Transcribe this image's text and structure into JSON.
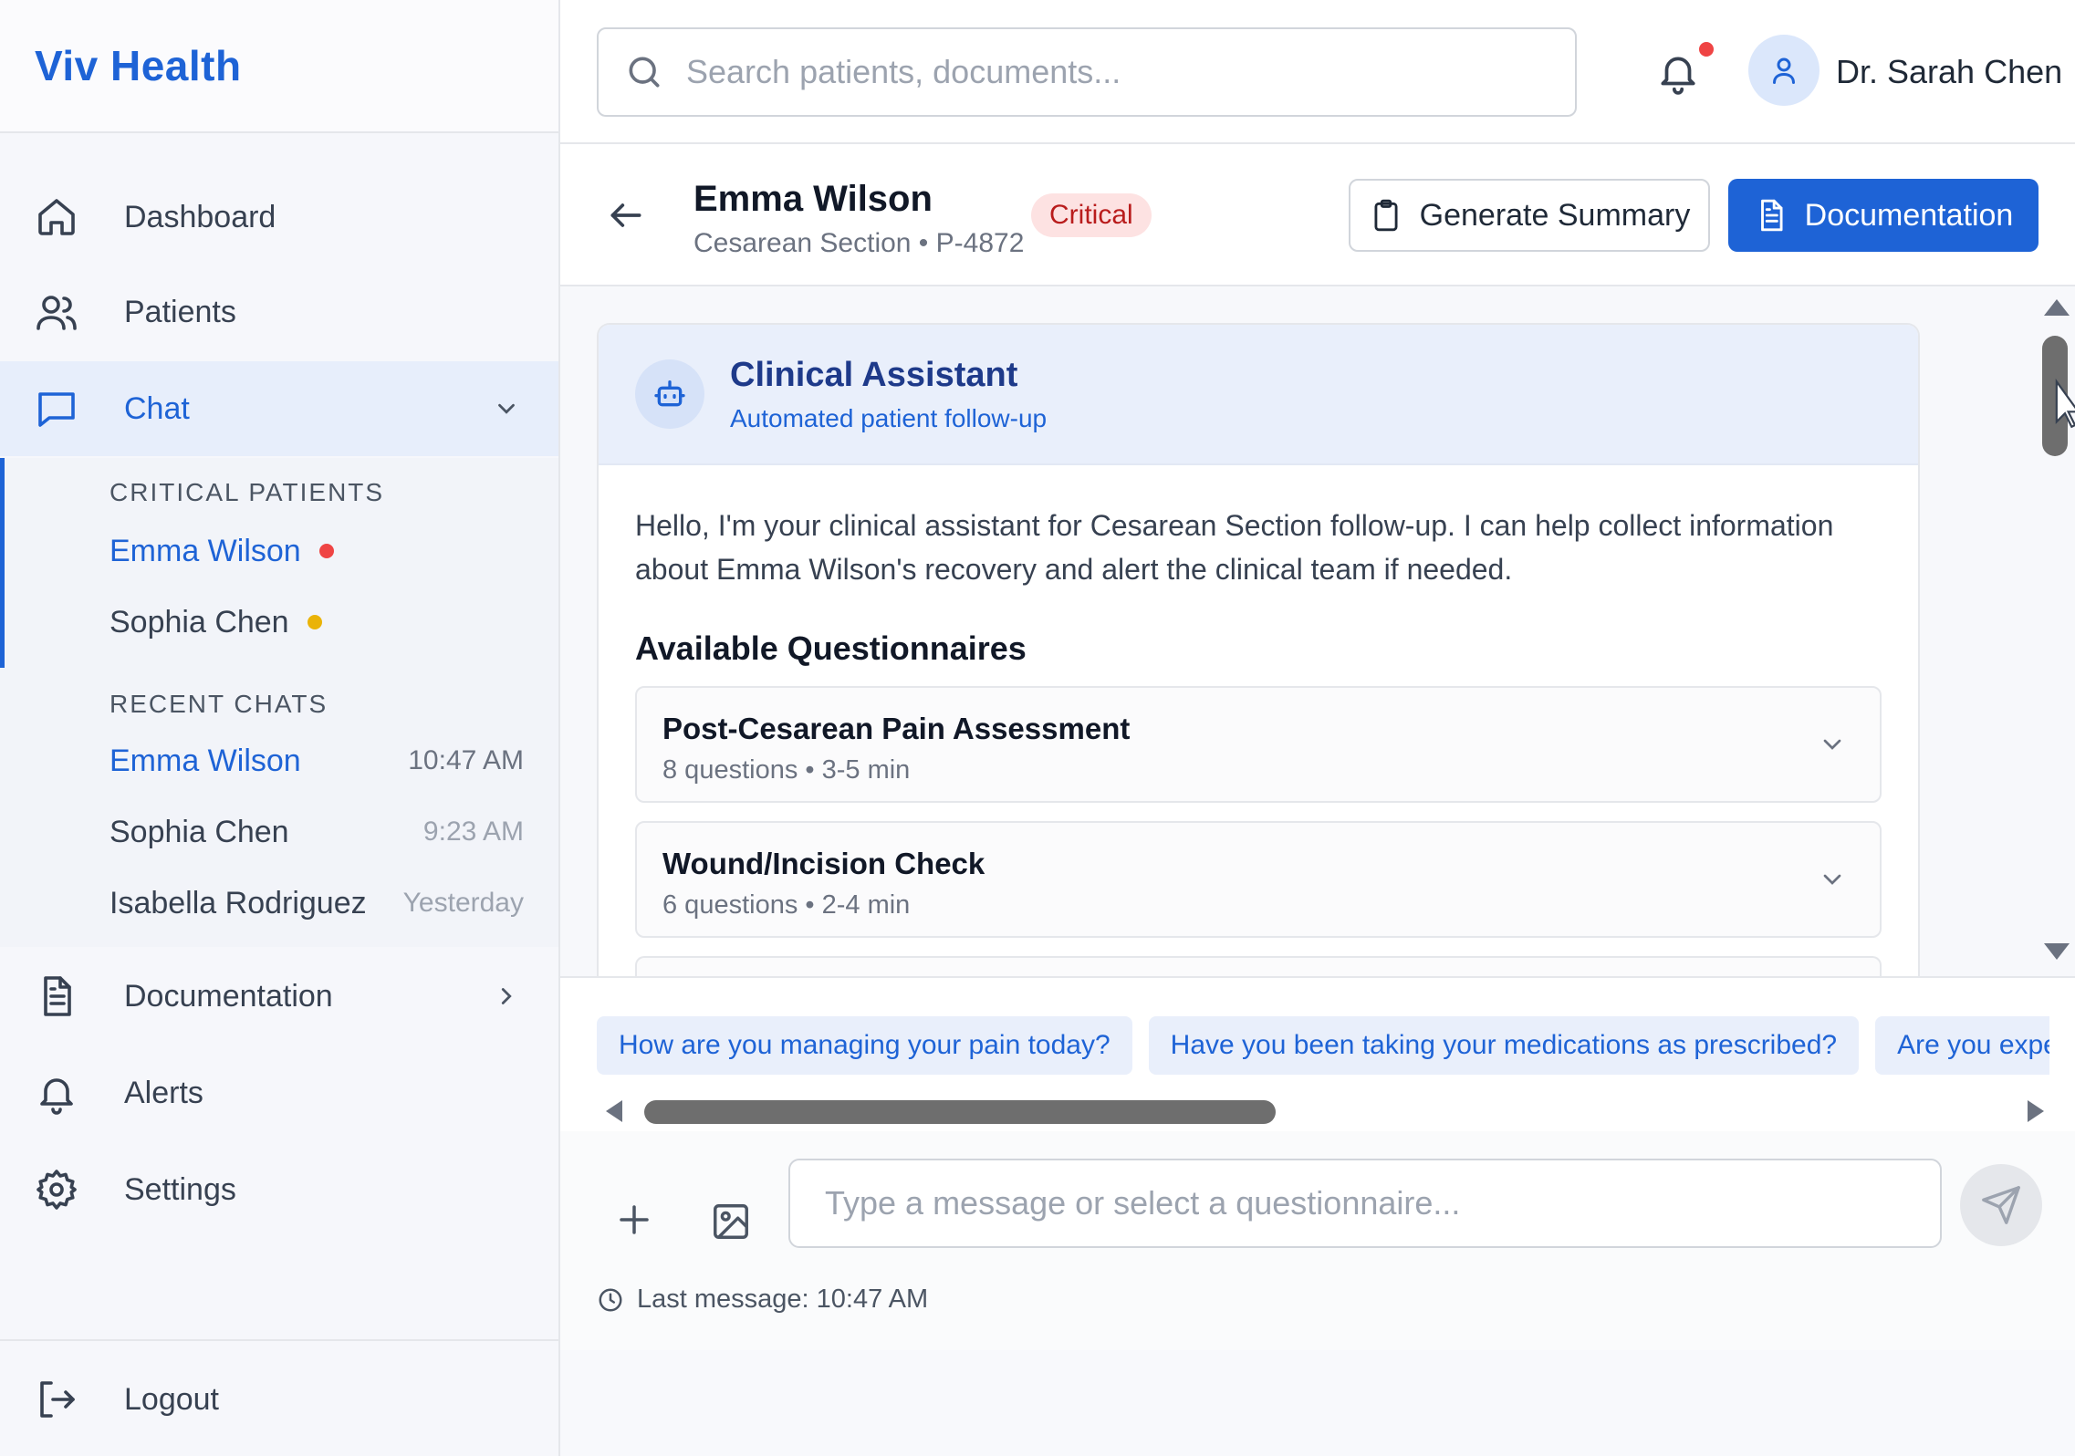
{
  "app": {
    "brand": "Viv Health"
  },
  "colors": {
    "accent": "#1e63d6",
    "critical": "#ef4444",
    "warning": "#eab308"
  },
  "sidebar": {
    "nav": [
      {
        "label": "Dashboard",
        "icon": "home-icon"
      },
      {
        "label": "Patients",
        "icon": "users-icon"
      },
      {
        "label": "Chat",
        "icon": "chat-icon",
        "active": true,
        "expanded": true
      },
      {
        "label": "Documentation",
        "icon": "document-icon"
      },
      {
        "label": "Alerts",
        "icon": "bell-icon"
      },
      {
        "label": "Settings",
        "icon": "gear-icon"
      }
    ],
    "critical_header": "CRITICAL PATIENTS",
    "critical": [
      {
        "name": "Emma Wilson",
        "status": "critical"
      },
      {
        "name": "Sophia Chen",
        "status": "warning"
      }
    ],
    "recent_header": "RECENT CHATS",
    "recent": [
      {
        "name": "Emma Wilson",
        "time": "10:47 AM"
      },
      {
        "name": "Sophia Chen",
        "time": "9:23 AM"
      },
      {
        "name": "Isabella Rodriguez",
        "time": "Yesterday"
      }
    ],
    "logout": "Logout"
  },
  "topbar": {
    "search_placeholder": "Search patients, documents...",
    "user_name": "Dr. Sarah Chen"
  },
  "patient": {
    "name": "Emma Wilson",
    "subtitle": "Cesarean Section • P-4872",
    "badge": "Critical",
    "generate_summary": "Generate Summary",
    "documentation": "Documentation"
  },
  "assistant": {
    "title": "Clinical Assistant",
    "subtitle": "Automated patient follow-up",
    "intro": "Hello, I'm your clinical assistant for Cesarean Section follow-up. I can help collect information about Emma Wilson's recovery and alert the clinical team if needed.",
    "section_title": "Available Questionnaires",
    "questionnaires": [
      {
        "title": "Post-Cesarean Pain Assessment",
        "meta": "8 questions • 3-5 min"
      },
      {
        "title": "Wound/Incision Check",
        "meta": "6 questions • 2-4 min"
      }
    ]
  },
  "suggestions": [
    "How are you managing your pain today?",
    "Have you been taking your medications as prescribed?",
    "Are you experie"
  ],
  "composer": {
    "placeholder": "Type a message or select a questionnaire...",
    "last_message": "Last message: 10:47 AM"
  }
}
